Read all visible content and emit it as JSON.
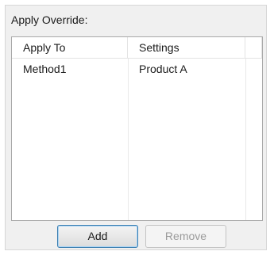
{
  "section": {
    "label": "Apply Override:"
  },
  "grid": {
    "columns": [
      "Apply To",
      "Settings"
    ],
    "rows": [
      [
        "Method1",
        "Product A"
      ]
    ]
  },
  "buttons": {
    "add_label": "Add",
    "remove_label": "Remove"
  }
}
